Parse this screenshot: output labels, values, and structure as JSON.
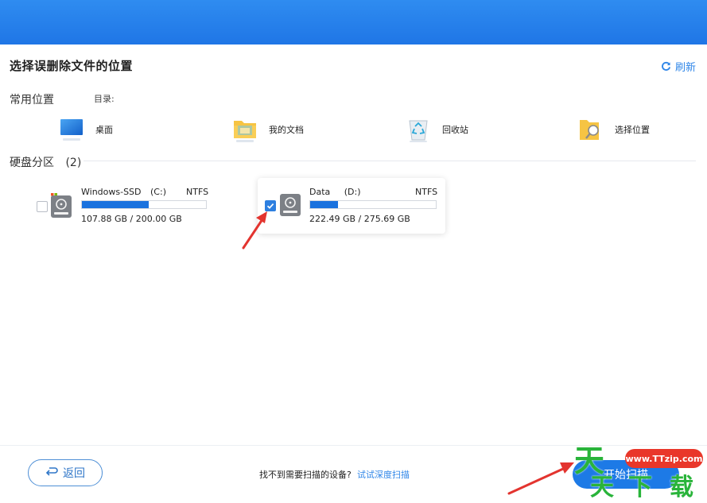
{
  "page": {
    "title": "选择误删除文件的位置",
    "refresh_label": "刷新"
  },
  "common": {
    "section_label": "常用位置",
    "dir_label": "目录:",
    "locations": [
      {
        "label": "桌面",
        "icon": "desktop-icon"
      },
      {
        "label": "我的文档",
        "icon": "documents-folder-icon"
      },
      {
        "label": "回收站",
        "icon": "recycle-bin-icon"
      },
      {
        "label": "选择位置",
        "icon": "folder-search-icon"
      }
    ]
  },
  "drives": {
    "section_label": "硬盘分区",
    "count": "(2)",
    "items": [
      {
        "name": "Windows-SSD",
        "letter": "(C:)",
        "fs": "NTFS",
        "size": "107.88 GB / 200.00 GB",
        "used_fraction": 0.539,
        "checked": false
      },
      {
        "name": "Data",
        "letter": "(D:)",
        "fs": "NTFS",
        "size": "222.49 GB / 275.69 GB",
        "used_fraction": 0.22,
        "checked": true
      }
    ]
  },
  "footer": {
    "back_label": "返回",
    "hint": "找不到需要扫描的设备?",
    "deep_scan_link": "试试深度扫描",
    "scan_label": "开始扫描"
  },
  "watermark": {
    "site": "www.TTzip.com",
    "glyph_1": "天",
    "glyph_2": "天",
    "glyph_3": "下",
    "glyph_4": "载"
  },
  "colors": {
    "accent": "#1d7ae6",
    "header": "#2f8cf0",
    "annotation_arrow": "#e3342f"
  }
}
